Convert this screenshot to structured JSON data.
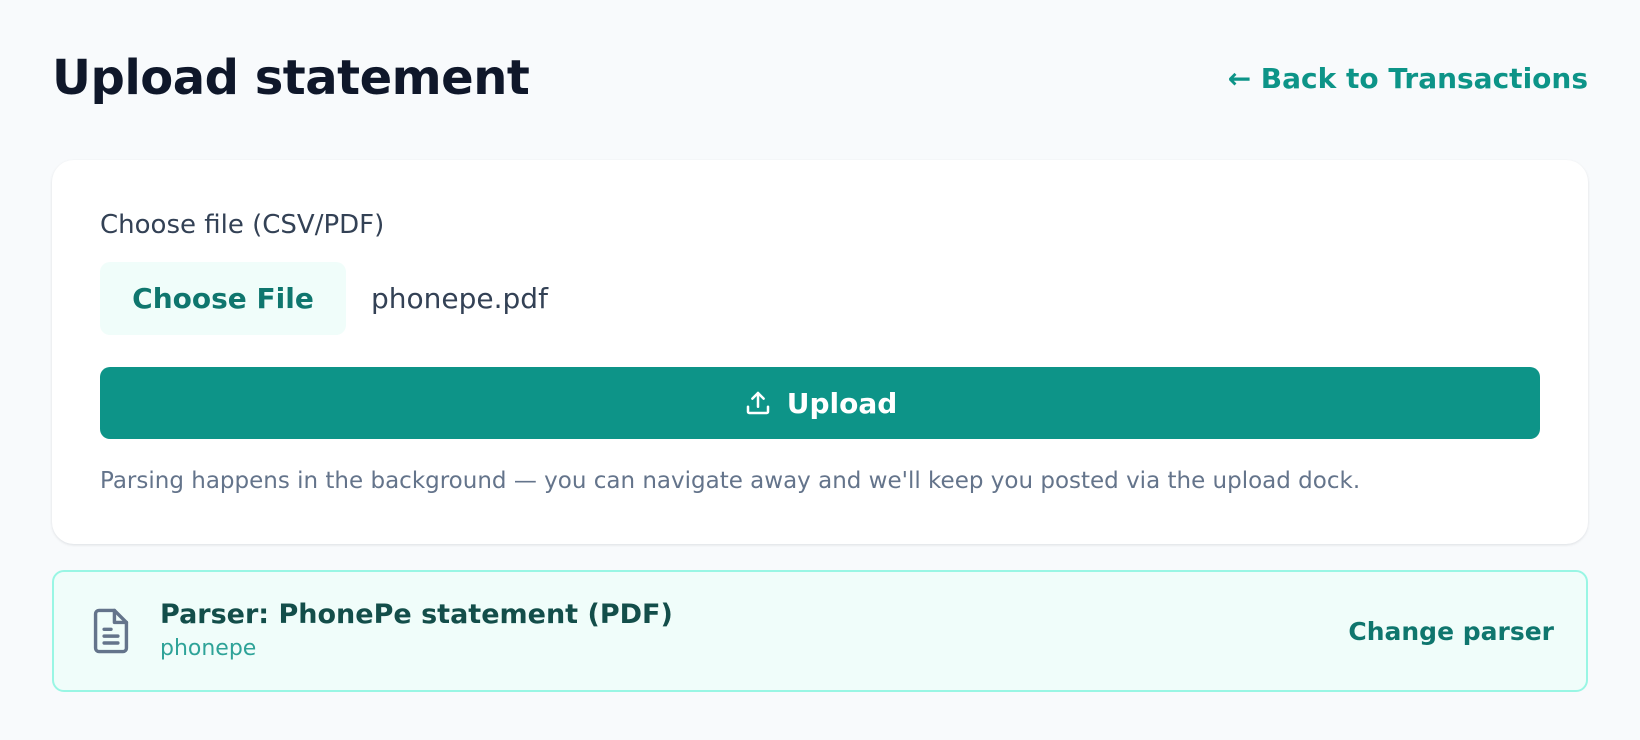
{
  "page": {
    "title": "Upload statement",
    "back_link": "← Back to Transactions"
  },
  "upload_card": {
    "field_label": "Choose file (CSV/PDF)",
    "choose_file_label": "Choose File",
    "selected_file": "phonepe.pdf",
    "upload_label": "Upload",
    "upload_icon": "upload-icon",
    "help_text": "Parsing happens in the background — you can navigate away and we'll keep you posted via the upload dock."
  },
  "parser": {
    "icon": "document-icon",
    "title": "Parser: PhonePe statement (PDF)",
    "id": "phonepe",
    "change_label": "Change parser"
  },
  "colors": {
    "accent": "#0d9488",
    "accent_dark": "#0f766e",
    "accent_light_bg": "#f0fdfa",
    "accent_border": "#99f6e4",
    "page_bg": "#f8fafc",
    "title_text": "#0f172a",
    "muted_text": "#64748b"
  }
}
